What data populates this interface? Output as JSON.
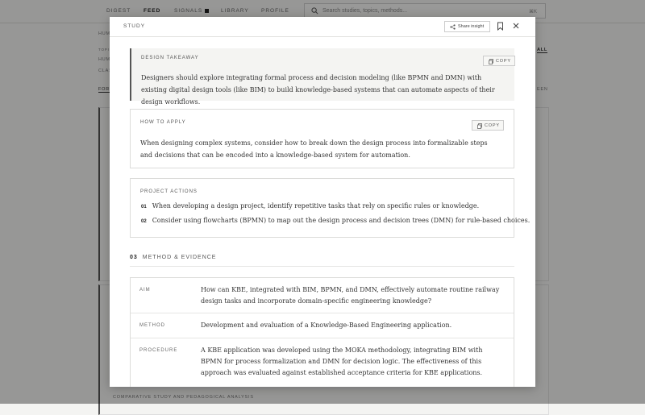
{
  "background": {
    "nav": [
      {
        "label": "DIGEST",
        "active": false
      },
      {
        "label": "FEED",
        "active": true
      },
      {
        "label": "SIGNALS",
        "active": false
      },
      {
        "label": "LIBRARY",
        "active": false
      },
      {
        "label": "PROFILE",
        "active": false
      }
    ],
    "search_placeholder": "Search studies, topics, methods...",
    "search_shortcut": "⌘K",
    "left_fragments": [
      "HUM",
      "TOPI",
      "HUM",
      "CLAS",
      "FOR"
    ],
    "right_fragments": [
      "ALL",
      "EEN"
    ],
    "bottom_caption": "COMPARATIVE STUDY AND PEDAGOGICAL ANALYSIS"
  },
  "modal": {
    "label": "STUDY",
    "share_label": "Share insight",
    "copy_label": "COPY",
    "takeaway": {
      "title": "DESIGN TAKEAWAY",
      "text": "Designers should explore integrating formal process and decision modeling (like BPMN and DMN) with existing digital design tools (like BIM) to build knowledge-based systems that can automate aspects of their design workflows."
    },
    "how_to_apply": {
      "title": "HOW TO APPLY",
      "text": "When designing complex systems, consider how to break down the design process into formalizable steps and decisions that can be encoded into a knowledge-based system for automation."
    },
    "project_actions": {
      "title": "PROJECT ACTIONS",
      "items": [
        {
          "num": "01",
          "text": "When developing a design project, identify repetitive tasks that rely on specific rules or knowledge."
        },
        {
          "num": "02",
          "text": "Consider using flowcharts (BPMN) to map out the design process and decision trees (DMN) for rule-based choices."
        }
      ]
    },
    "section": {
      "num": "03",
      "title": "METHOD & EVIDENCE"
    },
    "method_table": [
      {
        "key": "AIM",
        "value": "How can KBE, integrated with BIM, BPMN, and DMN, effectively automate routine railway design tasks and incorporate domain-specific engineering knowledge?"
      },
      {
        "key": "METHOD",
        "value": "Development and evaluation of a Knowledge-Based Engineering application."
      },
      {
        "key": "PROCEDURE",
        "value": "A KBE application was developed using the MOKA methodology, integrating BIM with BPMN for process formalization and DMN for decision logic. The effectiveness of this approach was evaluated against established acceptance criteria for KBE applications."
      }
    ]
  }
}
